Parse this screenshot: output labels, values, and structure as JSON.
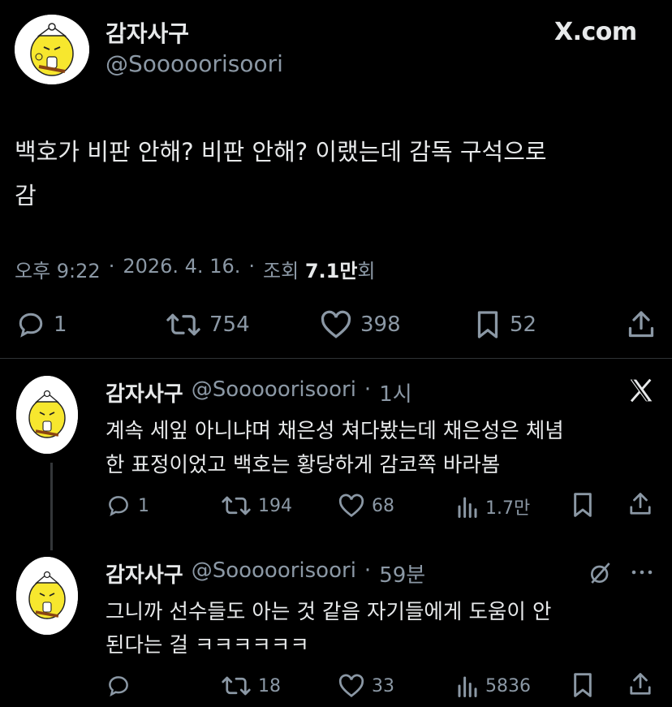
{
  "header": {
    "display_name": "감자사구",
    "handle": "@Sooooorisoori",
    "site_logo_text": "X.com"
  },
  "main_tweet": {
    "text_line1": "백호가 비판 안해? 비판 안해? 이랬는데 감독 구석으로",
    "text_line2": "감",
    "time": "오후 9:22",
    "date": "2026. 4. 16.",
    "views_label": "조회",
    "views_value": "7.1만",
    "views_suffix": "회",
    "replies": "1",
    "retweets": "754",
    "likes": "398",
    "bookmarks": "52"
  },
  "replies": [
    {
      "display_name": "감자사구",
      "handle": "@Sooooorisoori",
      "time": "1시",
      "text_line1": "계속 세잎 아니냐며 채은성 쳐다봤는데 채은성은 체념",
      "text_line2": "한 표정이었고 백호는 황당하게 감코쪽 바라봄",
      "replies": "1",
      "retweets": "194",
      "likes": "68",
      "views": "1.7만"
    },
    {
      "display_name": "감자사구",
      "handle": "@Sooooorisoori",
      "time": "59분",
      "text_line1": "그니까 선수들도 아는 것 같음 자기들에게 도움이 안",
      "text_line2": "된다는 걸 ㅋㅋㅋㅋㅋㅋ",
      "replies": "",
      "retweets": "18",
      "likes": "33",
      "views": "5836"
    }
  ],
  "icons": {
    "reply": "speech-bubble-icon",
    "retweet": "retweet-icon",
    "like": "heart-icon",
    "bookmark": "bookmark-icon",
    "share": "share-icon",
    "views": "bar-chart-icon",
    "x_logo": "x-logo-icon",
    "grok": "grok-icon",
    "more": "more-dots-icon"
  },
  "colors": {
    "background": "#000000",
    "text": "#e7e9ea",
    "muted": "#71767b",
    "divider": "#2f3336",
    "avatar_yellow": "#f7e72e"
  }
}
